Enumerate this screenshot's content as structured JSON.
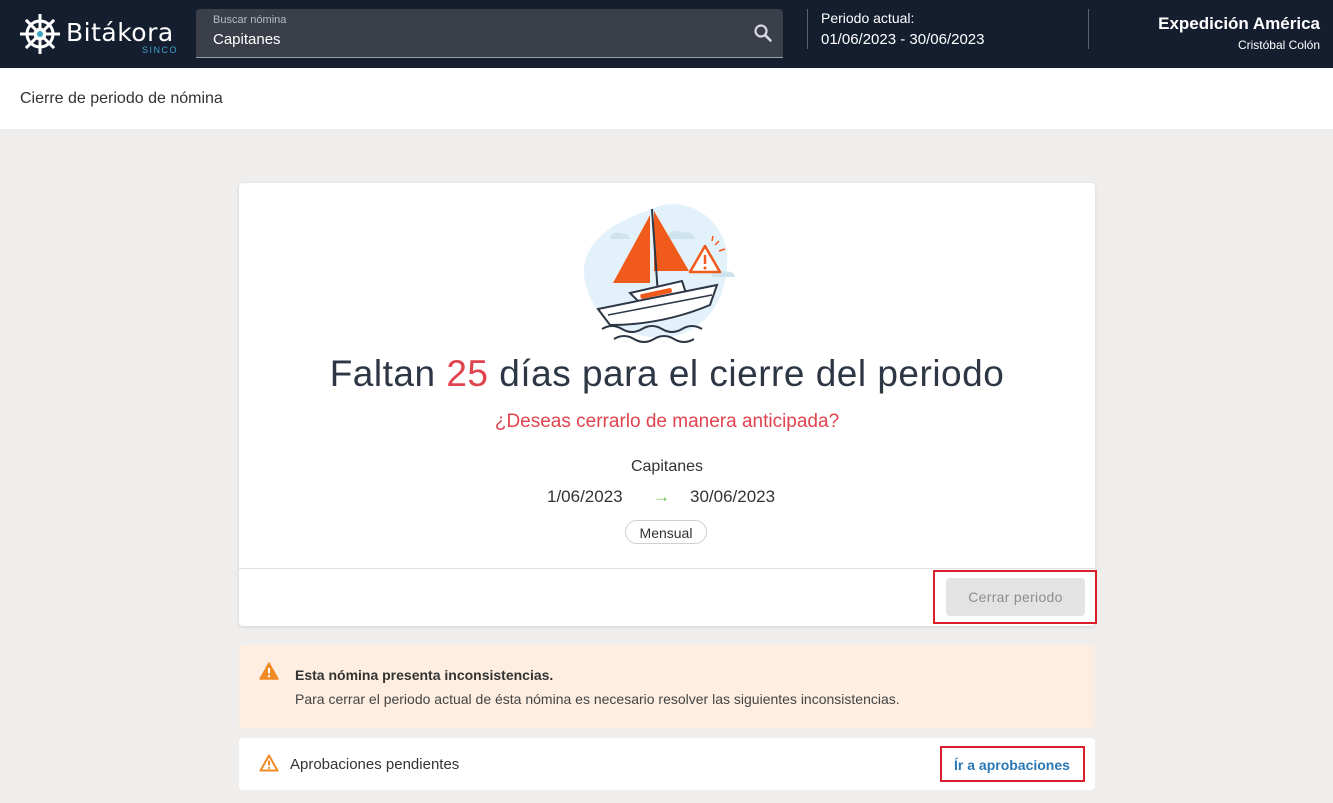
{
  "header": {
    "logo_text": "Bitákora",
    "logo_sub": "SINCO",
    "search": {
      "label": "Buscar nómina",
      "value": "Capitanes",
      "icon": "search-icon"
    },
    "period": {
      "label": "Periodo actual:",
      "value": "01/06/2023 - 30/06/2023"
    },
    "organization": "Expedición América",
    "user": "Cristóbal Colón"
  },
  "page": {
    "title": "Cierre de periodo de nómina"
  },
  "card": {
    "headline_prefix": "Faltan",
    "days": "25",
    "headline_suffix": "días para el cierre del periodo",
    "question": "¿Deseas cerrarlo de manera anticipada?",
    "payroll_name": "Capitanes",
    "start_date": "1/06/2023",
    "arrow": "→",
    "end_date": "30/06/2023",
    "frequency": "Mensual",
    "close_button": "Cerrar periodo"
  },
  "warning": {
    "title": "Esta nómina presenta inconsistencias.",
    "text": "Para cerrar el periodo actual de ésta nómina es necesario resolver las siguientes inconsistencias."
  },
  "approvals": {
    "label": "Aprobaciones pendientes",
    "link": "Ír a aprobaciones"
  },
  "colors": {
    "topbar": "#151e2f",
    "accent_red": "#e0434d",
    "arrow_green": "#6cc04a",
    "warning_orange": "#f08a24",
    "link_blue": "#2b78b4",
    "highlight_red": "#d81f2a"
  }
}
